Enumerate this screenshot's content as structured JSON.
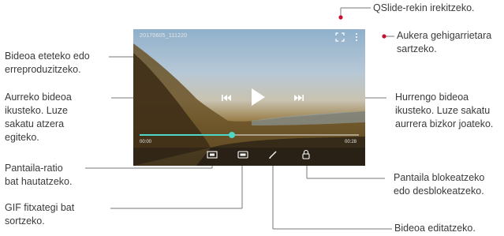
{
  "player": {
    "video_title": "20170605_111220",
    "elapsed": "00:00",
    "duration": "00:28",
    "progress": 0.42
  },
  "icons": {
    "qslide": "qslide-icon",
    "more": "more-options-icon",
    "previous": "previous-icon",
    "play": "play-icon",
    "next": "next-icon",
    "screen_ratio": "screen-ratio-icon",
    "gif": "gif-icon",
    "edit": "edit-pencil-icon",
    "lock": "lock-icon"
  },
  "callouts": {
    "qslide": "QSlide-rekin irekitzeko.",
    "more_line1": "Aukera gehigarrietara",
    "more_line2": "sartzeko.",
    "play_line1": "Bideoa eteteko edo",
    "play_line2": "erreproduzitzeko.",
    "prev_line1": "Aurreko bideoa",
    "prev_line2": "ikusteko. Luze",
    "prev_line3": "sakatu atzera",
    "prev_line4": "egiteko.",
    "next_line1": "Hurrengo bideoa",
    "next_line2": "ikusteko. Luze sakatu",
    "next_line3": "aurrera bizkor joateko.",
    "ratio_line1": "Pantaila-ratio",
    "ratio_line2": "bat hautatzeko.",
    "gif_line1": "GIF fitxategi bat",
    "gif_line2": "sortzeko.",
    "lock_line1": "Pantaila blokeatzeko",
    "lock_line2": "edo desblokeatzeko.",
    "edit": "Bideoa editatzeko."
  },
  "colors": {
    "accent": "#4dd7c8",
    "callout_marker": "#c8102e"
  }
}
